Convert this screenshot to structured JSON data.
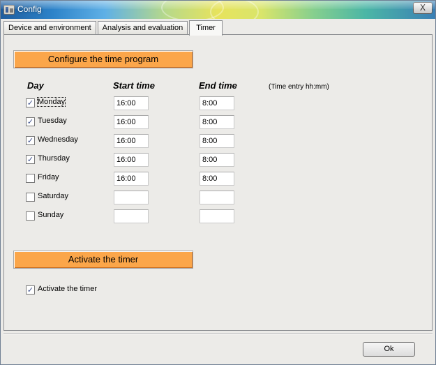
{
  "window": {
    "title": "Config",
    "close_label": "X"
  },
  "tabs": [
    {
      "label": "Device and environment"
    },
    {
      "label": "Analysis and evaluation"
    },
    {
      "label": "Timer",
      "active": true
    }
  ],
  "timer": {
    "configure_button": "Configure the time program",
    "headers": {
      "day": "Day",
      "start": "Start time",
      "end": "End time",
      "hint": "(Time entry hh:mm)"
    },
    "days": [
      {
        "label": "Monday",
        "checked": true,
        "start": "16:00",
        "end": "8:00"
      },
      {
        "label": "Tuesday",
        "checked": true,
        "start": "16:00",
        "end": "8:00"
      },
      {
        "label": "Wednesday",
        "checked": true,
        "start": "16:00",
        "end": "8:00"
      },
      {
        "label": "Thursday",
        "checked": true,
        "start": "16:00",
        "end": "8:00"
      },
      {
        "label": "Friday",
        "checked": false,
        "start": "16:00",
        "end": "8:00"
      },
      {
        "label": "Saturday",
        "checked": false,
        "start": "",
        "end": ""
      },
      {
        "label": "Sunday",
        "checked": false,
        "start": "",
        "end": ""
      }
    ],
    "activate_button": "Activate the timer",
    "activate_checkbox": {
      "label": "Activate the timer",
      "checked": true
    }
  },
  "footer": {
    "ok_label": "Ok"
  },
  "colors": {
    "section_button": "#fba64a",
    "window_bg": "#ecebe8"
  }
}
